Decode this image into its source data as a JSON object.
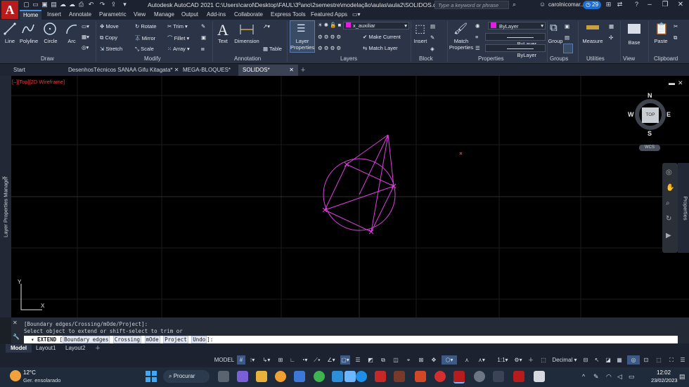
{
  "app": {
    "logo": "A",
    "title": "Autodesk AutoCAD 2021    C:\\Users\\carol\\Desktop\\FAUL\\3ºano\\2semestre\\modelação\\aulas\\aula2\\SOLIDOS.dwg"
  },
  "search": {
    "placeholder": "Type a keyword or phrase"
  },
  "user": {
    "name": "carolnicomar...",
    "badge": "29"
  },
  "ribbon_tabs": [
    "Home",
    "Insert",
    "Annotate",
    "Parametric",
    "View",
    "Manage",
    "Output",
    "Add-ins",
    "Collaborate",
    "Express Tools",
    "Featured Apps"
  ],
  "ribbon": {
    "draw": {
      "line": "Line",
      "polyline": "Polyline",
      "circle": "Circle",
      "arc": "Arc",
      "panel": "Draw"
    },
    "modify": {
      "move": "Move",
      "rotate": "Rotate",
      "trim": "Trim",
      "copy": "Copy",
      "mirror": "Mirror",
      "fillet": "Fillet",
      "stretch": "Stretch",
      "scale": "Scale",
      "array": "Array",
      "panel": "Modify"
    },
    "annotation": {
      "text": "Text",
      "dimension": "Dimension",
      "table": "Table",
      "panel": "Annotation"
    },
    "layers": {
      "properties": "Layer Properties",
      "current_layer": "x_auxiliar",
      "make_current": "Make Current",
      "match_layer": "Match Layer",
      "panel": "Layers"
    },
    "block": {
      "insert": "Insert",
      "panel": "Block"
    },
    "properties": {
      "match": "Match Properties",
      "color": "ByLayer",
      "linetype": "ByLayer",
      "lineweight": "ByLayer",
      "panel": "Properties"
    },
    "groups": {
      "group": "Group",
      "panel": "Groups"
    },
    "utilities": {
      "measure": "Measure",
      "panel": "Utilities"
    },
    "view": {
      "base": "Base",
      "panel": "View"
    },
    "clipboard": {
      "paste": "Paste",
      "panel": "Clipboard"
    }
  },
  "file_tabs": [
    "Start",
    "DesenhosTécnicos SANAA Gifu Kitagata*",
    "MEGA-BLOQUES*",
    "SOLIDOS*"
  ],
  "viewport": {
    "label": "[–][Top][2D Wireframe]"
  },
  "viewcube": {
    "n": "N",
    "s": "S",
    "e": "E",
    "w": "W",
    "top": "TOP",
    "wcs": "WCS"
  },
  "ucs": {
    "x": "X",
    "y": "Y"
  },
  "palettes": {
    "left": "Layer Properties Manager",
    "right": "Properties"
  },
  "command": {
    "history1": "[Boundary edges/Crossing/mOde/Project]:",
    "history2": "Select object to extend or shift-select to trim or",
    "prompt": "EXTEND",
    "options": [
      "Boundary edges",
      "Crossing",
      "mOde",
      "Project",
      "Undo"
    ],
    "suffix": "]:"
  },
  "layout_tabs": [
    "Model",
    "Layout1",
    "Layout2"
  ],
  "status": {
    "model": "MODEL",
    "scale": "1:1",
    "units": "Decimal"
  },
  "taskbar": {
    "temp": "12°C",
    "weather": "Ger. ensolarado",
    "search": "Procurar",
    "time": "12:02",
    "date": "23/02/2023"
  },
  "colors": {
    "accent": "#4a90e2",
    "geometry": "#e040e0",
    "layer_swatch": "#e020e0"
  }
}
